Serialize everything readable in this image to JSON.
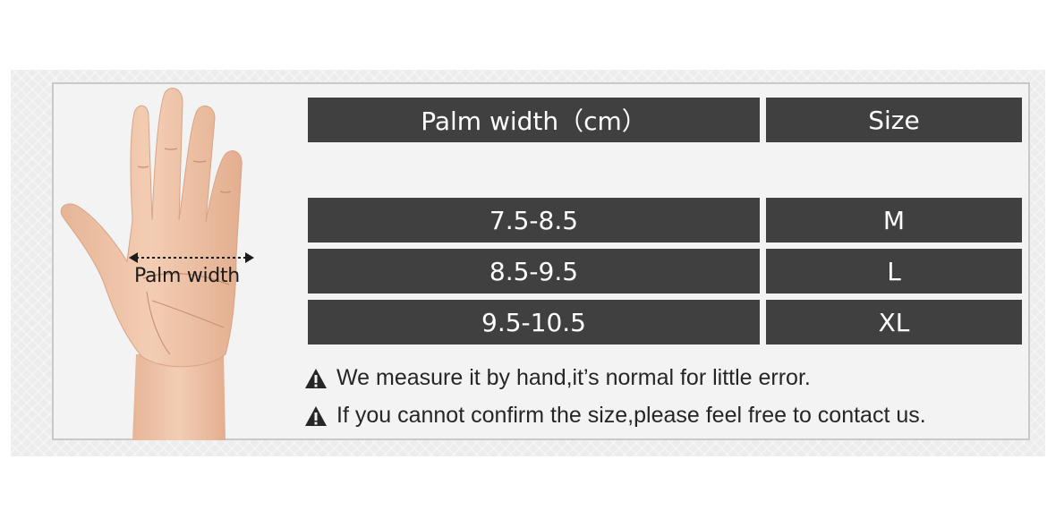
{
  "hand_image": {
    "label": "Palm width",
    "icon": "hand-icon"
  },
  "size_table": {
    "headers": [
      "Palm width（cm）",
      "Size"
    ],
    "rows": [
      {
        "range": "7.5-8.5",
        "size": "M"
      },
      {
        "range": "8.5-9.5",
        "size": "L"
      },
      {
        "range": "9.5-10.5",
        "size": "XL"
      }
    ]
  },
  "notes": [
    {
      "icon": "warning-icon",
      "text": "We measure it by hand,it’s normal for little error."
    },
    {
      "icon": "warning-icon",
      "text": "If you cannot confirm the size,please feel free to contact us."
    }
  ],
  "colors": {
    "cell_background": "#404040",
    "cell_text": "#ffffff",
    "panel_background": "#f3f3f3"
  }
}
